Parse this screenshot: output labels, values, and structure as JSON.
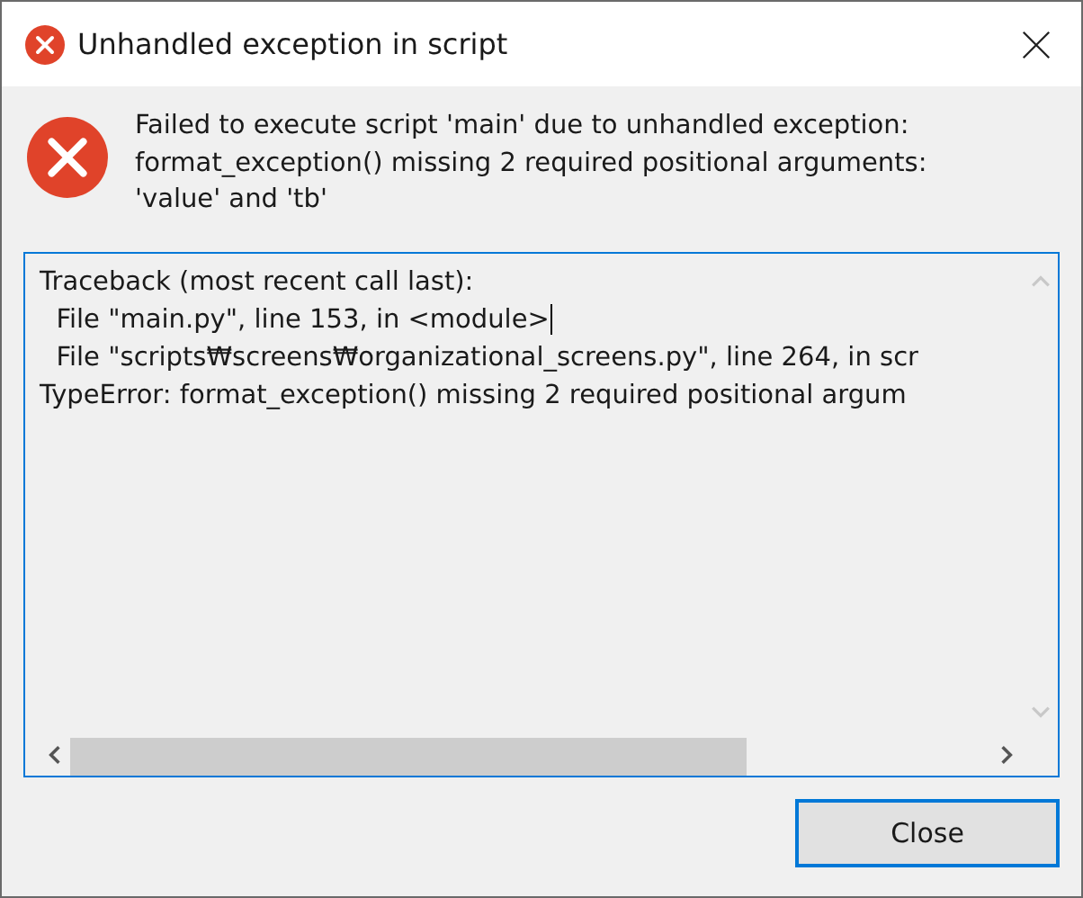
{
  "window": {
    "title": "Unhandled exception in script"
  },
  "message": "Failed to execute script 'main' due to unhandled exception:\nformat_exception() missing 2 required positional arguments:\n'value' and 'tb'",
  "traceback": {
    "lines": [
      {
        "text": "Traceback (most recent call last):",
        "cursor": false
      },
      {
        "text": "  File \"main.py\", line 153, in <module>",
        "cursor": true
      },
      {
        "text": "  File \"scripts₩screens₩organizational_screens.py\", line 264, in scr",
        "cursor": false
      },
      {
        "text": "TypeError: format_exception() missing 2 required positional argum",
        "cursor": false
      }
    ]
  },
  "buttons": [
    {
      "label": "Close",
      "focused": true
    }
  ]
}
